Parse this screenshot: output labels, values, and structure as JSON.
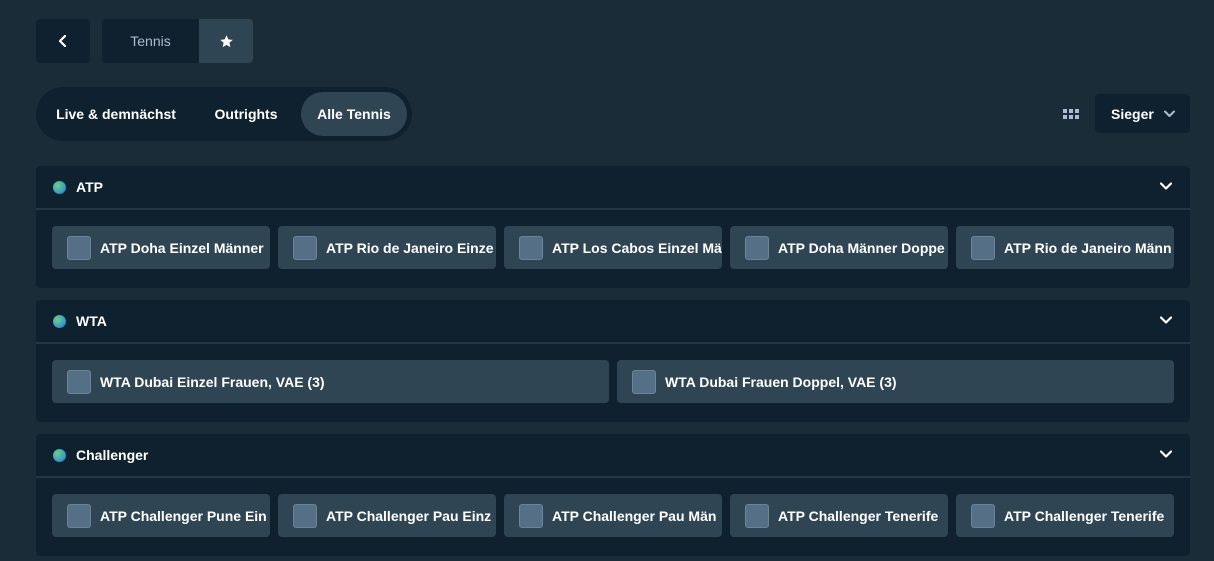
{
  "nav": {
    "breadcrumb": "Tennis"
  },
  "tabs": [
    {
      "label": "Live & demnächst"
    },
    {
      "label": "Outrights"
    },
    {
      "label": "Alle Tennis"
    }
  ],
  "market_select": {
    "value": "Sieger"
  },
  "sections": [
    {
      "title": "ATP",
      "items": [
        "ATP Doha Einzel Männer",
        "ATP Rio de Janeiro Einze",
        "ATP Los Cabos Einzel Mä",
        "ATP Doha Männer Doppe",
        "ATP Rio de Janeiro Männ"
      ]
    },
    {
      "title": "WTA",
      "items": [
        "WTA Dubai Einzel Frauen, VAE (3)",
        "WTA Dubai Frauen Doppel, VAE (3)"
      ]
    },
    {
      "title": "Challenger",
      "items": [
        "ATP Challenger Pune Ein",
        "ATP Challenger Pau Einz",
        "ATP Challenger Pau Män",
        "ATP Challenger Tenerife",
        "ATP Challenger Tenerife"
      ]
    }
  ],
  "colors": {
    "background": "#1a2c38",
    "panel": "#0f212e",
    "card": "#2f4553",
    "text": "#ffffff",
    "muted": "#b1bad3"
  }
}
